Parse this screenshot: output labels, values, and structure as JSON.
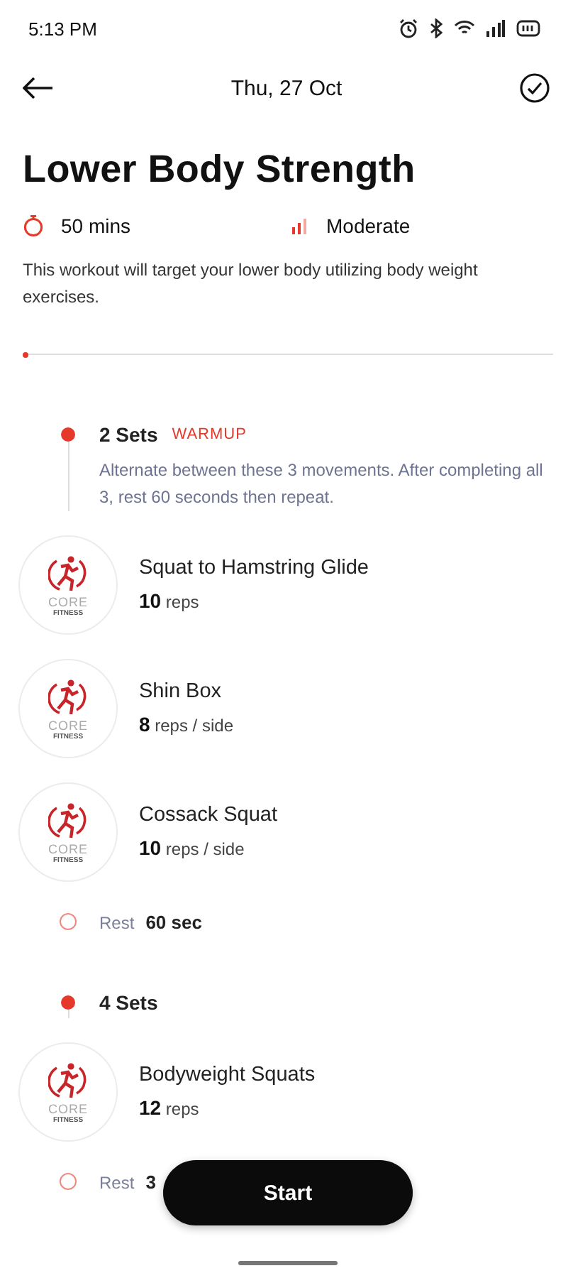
{
  "status_bar": {
    "time": "5:13 PM"
  },
  "header": {
    "date": "Thu, 27 Oct"
  },
  "workout": {
    "title": "Lower Body Strength",
    "duration": "50 mins",
    "difficulty": "Moderate",
    "description": "This workout will target your lower body utilizing body weight exercises.",
    "progress": {
      "level": 0.01
    }
  },
  "groups": [
    {
      "sets": "2 Sets",
      "tag": "WARMUP",
      "note": "Alternate between these 3 movements. After completing all 3, rest 60 seconds then repeat.",
      "exercises": [
        {
          "name": "Squat to Hamstring Glide",
          "count": "10",
          "unit": "reps",
          "logo": [
            "CORE",
            "FITNESS"
          ]
        },
        {
          "name": "Shin Box",
          "count": "8",
          "unit": "reps / side",
          "logo": [
            "CORE",
            "FITNESS"
          ]
        },
        {
          "name": "Cossack Squat",
          "count": "10",
          "unit": "reps / side",
          "logo": [
            "CORE",
            "FITNESS"
          ]
        }
      ],
      "rest": {
        "label": "Rest",
        "value": "60 sec"
      }
    },
    {
      "sets": "4 Sets",
      "exercises": [
        {
          "name": "Bodyweight Squats",
          "count": "12",
          "unit": "reps",
          "logo": [
            "CORE",
            "FITNESS"
          ]
        }
      ],
      "rest": {
        "label": "Rest",
        "value": "3"
      }
    }
  ],
  "start_button": "Start"
}
